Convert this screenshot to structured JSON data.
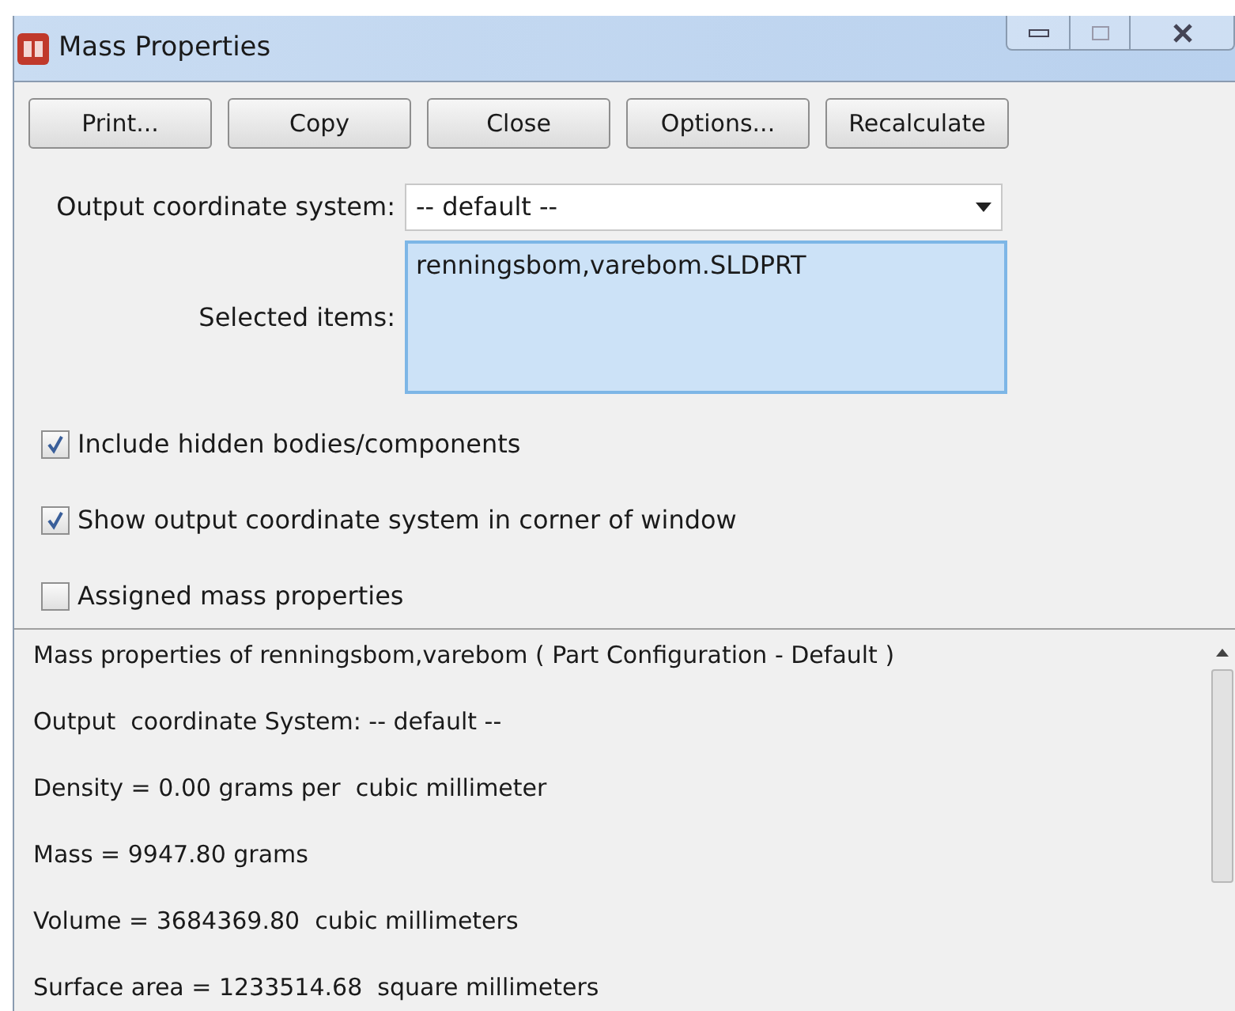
{
  "window": {
    "title": "Mass Properties"
  },
  "buttons": [
    "Print...",
    "Copy",
    "Close",
    "Options...",
    "Recalculate"
  ],
  "output_coordinate_system": {
    "label": "Output coordinate system:",
    "value": "-- default --"
  },
  "selected_items": {
    "label": "Selected items:",
    "items": [
      "renningsbom,varebom.SLDPRT"
    ]
  },
  "options": [
    {
      "label": "Include hidden bodies/components",
      "checked": true
    },
    {
      "label": "Show output coordinate system in corner of window",
      "checked": true
    },
    {
      "label": "Assigned mass properties",
      "checked": false
    }
  ],
  "results": [
    "Mass properties of renningsbom,varebom ( Part Configuration - Default )",
    "Output  coordinate System: -- default --",
    "Density = 0.00 grams per  cubic millimeter",
    "Mass = 9947.80 grams",
    "Volume = 3684369.80  cubic millimeters",
    "Surface area = 1233514.68  square millimeters"
  ]
}
